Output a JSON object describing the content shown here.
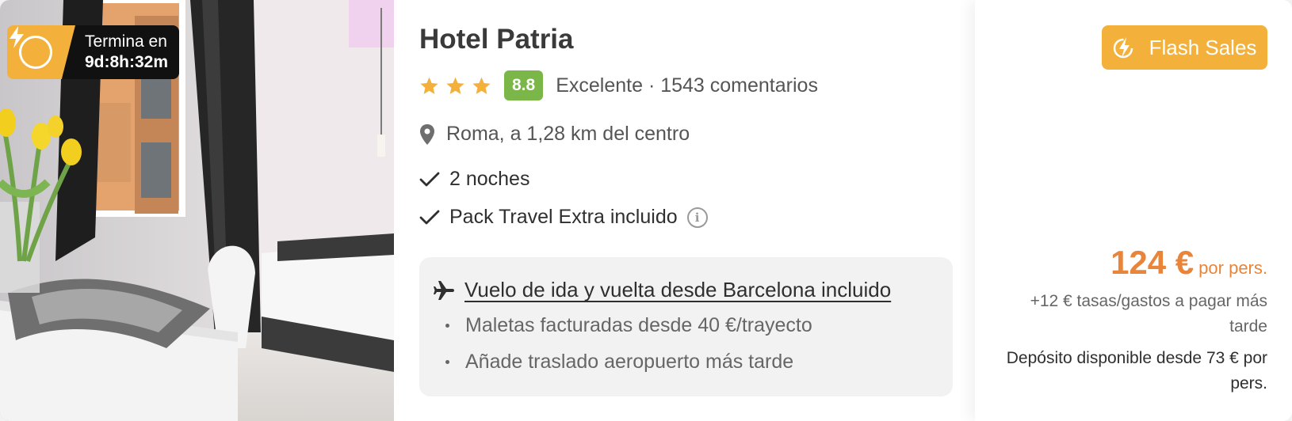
{
  "hotel": {
    "name": "Hotel Patria",
    "stars": 3,
    "score": "8.8",
    "rating_text": "Excelente · 1543 comentarios",
    "location": "Roma, a 1,28 km del centro"
  },
  "timer": {
    "label": "Termina en",
    "time": "9d:8h:32m",
    "icon": "flash-clock-icon"
  },
  "features": [
    {
      "label": "2 noches",
      "icon": "check-icon"
    },
    {
      "label": "Pack Travel Extra incluido",
      "icon": "check-icon",
      "info_icon": "info-icon"
    }
  ],
  "flight": {
    "title": "Vuelo de ida y vuelta desde Barcelona incluido",
    "icon": "plane-icon",
    "items": [
      "Maletas facturadas desde 40 €/trayecto",
      "Añade traslado aeropuerto más tarde"
    ]
  },
  "price": {
    "badge": "Flash Sales",
    "value": "124 €",
    "unit": "por pers.",
    "fees": "+12 € tasas/gastos a pagar más tarde",
    "deposit": "Depósito disponible desde 73 € por pers."
  },
  "colors": {
    "accent": "#f3b13c",
    "price": "#e8853a",
    "score_bg": "#7ab648",
    "star": "#f3b13c"
  }
}
